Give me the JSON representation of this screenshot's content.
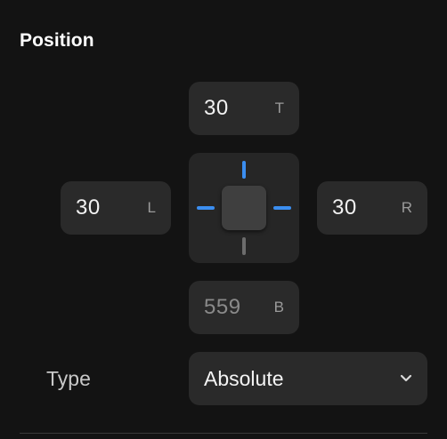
{
  "section": {
    "title": "Position"
  },
  "position": {
    "top": {
      "value": "30",
      "suffix": "T"
    },
    "left": {
      "value": "30",
      "suffix": "L"
    },
    "right": {
      "value": "30",
      "suffix": "R"
    },
    "bottom": {
      "value": "559",
      "suffix": "B"
    }
  },
  "constraints": {
    "top_pinned": true,
    "left_pinned": true,
    "right_pinned": true,
    "bottom_pinned": false,
    "active_color": "#3b8ef0",
    "inactive_color": "#6c6c6c"
  },
  "type": {
    "label": "Type",
    "selected": "Absolute",
    "icon": "chevron-down-icon"
  }
}
